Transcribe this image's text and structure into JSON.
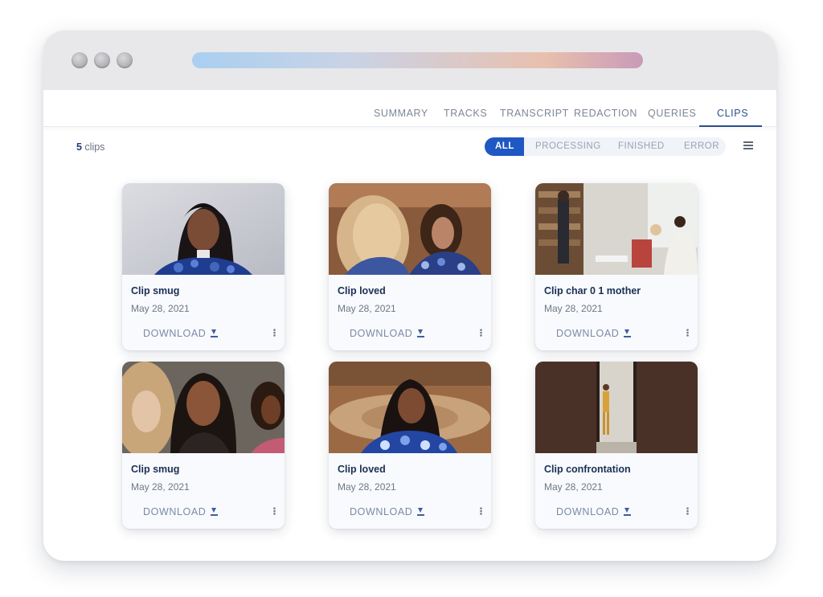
{
  "window": {
    "traffic_lights": [
      "close",
      "minimize",
      "maximize"
    ],
    "url_gradient": [
      "#a9cff0",
      "#e9c0ae",
      "#c89bb7"
    ]
  },
  "tabs": [
    {
      "label": "SUMMARY"
    },
    {
      "label": "TRACKS"
    },
    {
      "label": "TRANSCRIPT"
    },
    {
      "label": "REDACTION"
    },
    {
      "label": "QUERIES"
    },
    {
      "label": "CLIPS",
      "active": true
    }
  ],
  "toolbar": {
    "count": "5",
    "count_suffix": " clips",
    "filters": [
      {
        "label": "ALL",
        "active": true
      },
      {
        "label": "PROCESSING"
      },
      {
        "label": "FINISHED"
      },
      {
        "label": "ERROR"
      }
    ],
    "list_view_icon": "list-icon"
  },
  "clips": [
    {
      "title": "Clip smug",
      "date": "May 28, 2021",
      "download": "DOWNLOAD"
    },
    {
      "title": "Clip loved",
      "date": "May 28, 2021",
      "download": "DOWNLOAD"
    },
    {
      "title": "Clip char 0 1 mother",
      "date": "May 28, 2021",
      "download": "DOWNLOAD"
    },
    {
      "title": "Clip smug",
      "date": "May 28, 2021",
      "download": "DOWNLOAD"
    },
    {
      "title": "Clip loved",
      "date": "May 28, 2021",
      "download": "DOWNLOAD"
    },
    {
      "title": "Clip confrontation",
      "date": "May 28, 2021",
      "download": "DOWNLOAD"
    }
  ],
  "colors": {
    "accent": "#1f57c3",
    "active_tab": "#2c4f8c",
    "card_title": "#1b2f55"
  }
}
